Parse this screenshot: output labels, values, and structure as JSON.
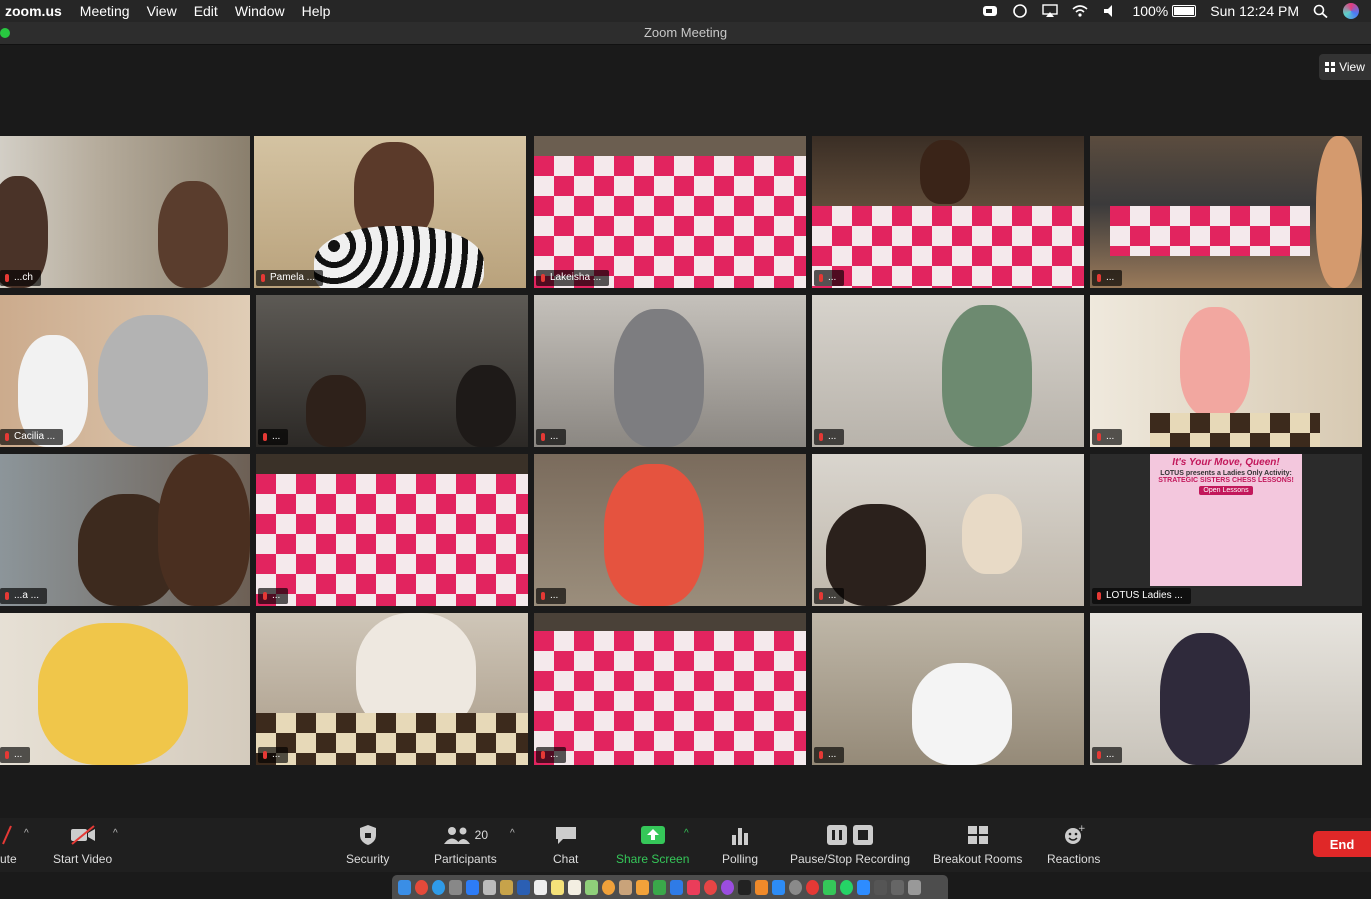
{
  "menubar": {
    "app": "zoom.us",
    "menus": [
      "Meeting",
      "View",
      "Edit",
      "Window",
      "Help"
    ],
    "battery": "100%",
    "clock": "Sun 12:24 PM"
  },
  "window": {
    "title": "Zoom Meeting"
  },
  "view_button": {
    "label": "View"
  },
  "tiles": [
    {
      "name": "...ch"
    },
    {
      "name": "Pamela ..."
    },
    {
      "name": "Lakeisha ..."
    },
    {
      "name": "..."
    },
    {
      "name": "..."
    },
    {
      "name": "Cacilia ..."
    },
    {
      "name": "..."
    },
    {
      "name": "..."
    },
    {
      "name": "..."
    },
    {
      "name": "..."
    },
    {
      "name": "...a ..."
    },
    {
      "name": "..."
    },
    {
      "name": "..."
    },
    {
      "name": "..."
    },
    {
      "name": "LOTUS Ladies ..."
    },
    {
      "name": "..."
    },
    {
      "name": "..."
    },
    {
      "name": "..."
    },
    {
      "name": "..."
    },
    {
      "name": "..."
    }
  ],
  "flyer": {
    "line1": "It's Your Move, Queen!",
    "line2": "LOTUS presents a Ladies Only Activity:",
    "line3": "STRATEGIC SISTERS CHESS LESSONS!",
    "button": "Open Lessons"
  },
  "toolbar": {
    "mute": "ute",
    "start_video": "Start Video",
    "security": "Security",
    "participants": "Participants",
    "participant_count": "20",
    "chat": "Chat",
    "share_screen": "Share Screen",
    "polling": "Polling",
    "recording": "Pause/Stop Recording",
    "breakout": "Breakout Rooms",
    "reactions": "Reactions",
    "end": "End"
  },
  "colors": {
    "active_speaker": "#c8e650",
    "end_button": "#e02828",
    "share_green": "#35c759"
  }
}
